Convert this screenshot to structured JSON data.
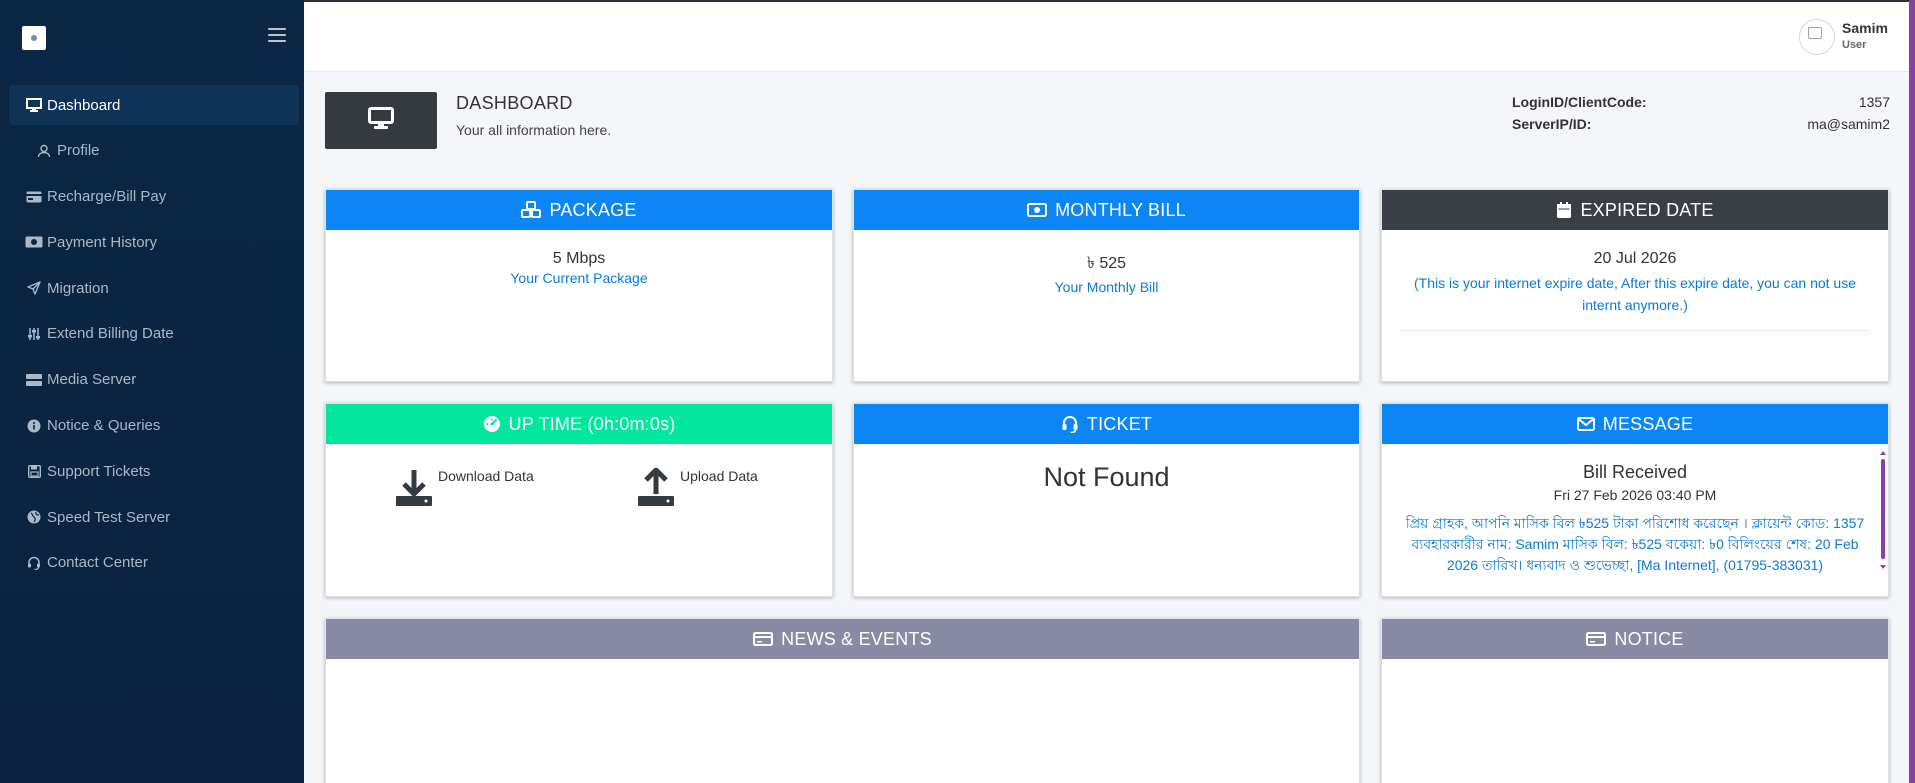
{
  "sidebar": {
    "items": [
      {
        "label": "Dashboard",
        "icon": "monitor-icon"
      },
      {
        "label": "Profile",
        "icon": "user-icon"
      },
      {
        "label": "Recharge/Bill Pay",
        "icon": "card-icon"
      },
      {
        "label": "Payment History",
        "icon": "money-icon"
      },
      {
        "label": "Migration",
        "icon": "paper-plane-icon"
      },
      {
        "label": "Extend Billing Date",
        "icon": "sliders-icon"
      },
      {
        "label": "Media Server",
        "icon": "server-icon"
      },
      {
        "label": "Notice & Queries",
        "icon": "info-icon"
      },
      {
        "label": "Support Tickets",
        "icon": "save-icon"
      },
      {
        "label": "Speed Test Server",
        "icon": "globe-icon"
      },
      {
        "label": "Contact Center",
        "icon": "headset-icon"
      }
    ]
  },
  "user": {
    "name": "Samim",
    "role": "User"
  },
  "header": {
    "title": "DASHBOARD",
    "subtitle": "Your all information here.",
    "login_label": "LoginID/ClientCode:",
    "login_value": "1357",
    "server_label": "ServerIP/ID:",
    "server_value": "ma@samim2"
  },
  "cards": {
    "package": {
      "title": "PACKAGE",
      "value": "5 Mbps",
      "caption": "Your Current Package"
    },
    "bill": {
      "title": "MONTHLY BILL",
      "value": "৳ 525",
      "caption": "Your Monthly Bill"
    },
    "expired": {
      "title": "EXPIRED DATE",
      "value": "20 Jul 2026",
      "caption": "(This is your internet expire date, After this expire date, you can not use internt anymore.)"
    },
    "uptime": {
      "title": "UP TIME (0h:0m:0s)",
      "download": "Download Data",
      "upload": "Upload Data"
    },
    "ticket": {
      "title": "TICKET",
      "value": "Not Found"
    },
    "message": {
      "title": "MESSAGE",
      "subject": "Bill Received",
      "date": "Fri 27 Feb 2026 03:40 PM",
      "text": "প্রিয় গ্রাহক, আপনি মাসিক বিল ৳525 টাকা পরিশোধ করেছেন । ক্লায়েন্ট কোড: 1357 ব্যবহারকারীর নাম: Samim মাসিক বিল: ৳525 বকেয়া: ৳0 বিলিংয়ের শেষ: 20 Feb 2026 তারিখ। ধন্যবাদ ও শুভেচ্ছা, [Ma Internet], (01795-383031)"
    },
    "news": {
      "title": "NEWS & EVENTS"
    },
    "notice": {
      "title": "NOTICE"
    }
  },
  "colors": {
    "sidebar_bg": "#0b2744",
    "primary_blue": "#0d86f5",
    "dark_header": "#3a3f45",
    "green_header": "#02e69e",
    "grey_header": "#898aa3",
    "link_blue": "#0b7ad6",
    "accent_purple": "#8d3ea3"
  }
}
